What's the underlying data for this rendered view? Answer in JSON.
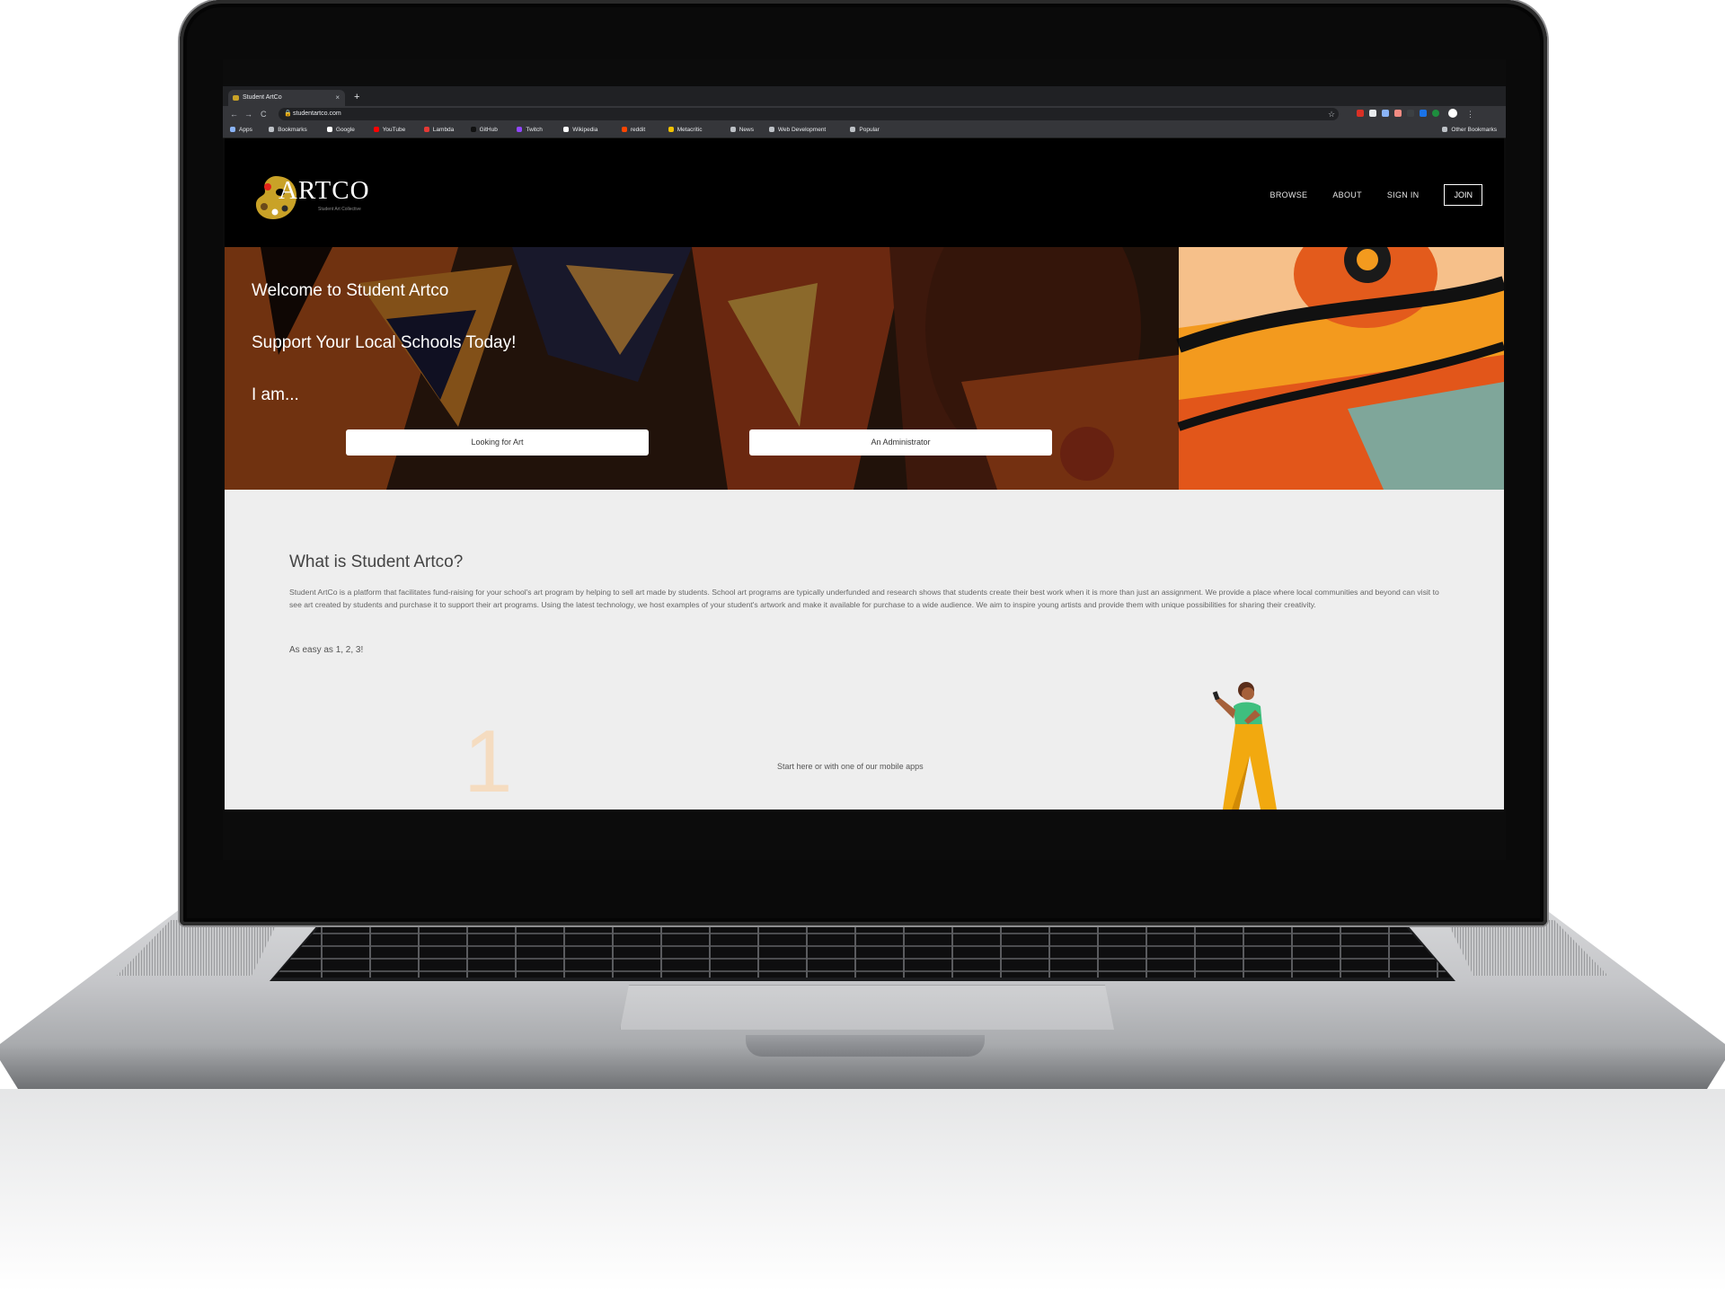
{
  "browser": {
    "tab_title": "Student ArtCo",
    "tab_close": "×",
    "new_tab": "+",
    "url": "studentartco.com",
    "nav": {
      "back": "←",
      "forward": "→",
      "reload": "C"
    },
    "star": "☆",
    "menu": "⋮",
    "bookmarks": [
      {
        "label": "Apps",
        "color": "#8ab4f8"
      },
      {
        "label": "Bookmarks",
        "color": "#bdc1c6"
      },
      {
        "label": "Google",
        "color": "#ffffff"
      },
      {
        "label": "YouTube",
        "color": "#ff0000"
      },
      {
        "label": "Lambda",
        "color": "#e53935"
      },
      {
        "label": "GitHub",
        "color": "#111111"
      },
      {
        "label": "Twitch",
        "color": "#9146ff"
      },
      {
        "label": "Wikipedia",
        "color": "#ffffff"
      },
      {
        "label": "reddit",
        "color": "#ff4500"
      },
      {
        "label": "Metacritic",
        "color": "#f2c200"
      },
      {
        "label": "News",
        "color": "#bdc1c6"
      },
      {
        "label": "Web Development",
        "color": "#bdc1c6"
      },
      {
        "label": "Popular",
        "color": "#bdc1c6"
      }
    ],
    "other_bookmarks": "Other Bookmarks"
  },
  "site": {
    "logo": {
      "wordmark": "ARTCO",
      "tagline": "Student Art Collective"
    },
    "nav": {
      "browse": "BROWSE",
      "about": "ABOUT",
      "sign_in": "SIGN IN",
      "join": "JOIN"
    },
    "hero": {
      "welcome": "Welcome to Student Artco",
      "support": "Support Your Local Schools Today!",
      "i_am": "I am...",
      "btn_art": "Looking for Art",
      "btn_admin": "An Administrator"
    },
    "about": {
      "title": "What is Student Artco?",
      "description": "Student ArtCo is a platform that facilitates fund-raising for your school's art program by helping to sell art made by students. School art programs are typically underfunded and research shows that students create their best work when it is more than just an assignment. We provide a place where local communities and beyond can visit to see art created by students and purchase it to support their art programs. Using the latest technology, we host examples of your student's artwork and make it available for purchase to a wide audience. We aim to inspire young artists and provide them with unique possibilities for sharing their creativity.",
      "easy": "As easy as 1, 2, 3!",
      "step_number": "1",
      "step_text": "Start here or with one of our mobile apps"
    }
  },
  "colors": {
    "brand_gold": "#c9a227",
    "hero_orange": "#f39a1e",
    "page_bg": "#eeeeee"
  }
}
